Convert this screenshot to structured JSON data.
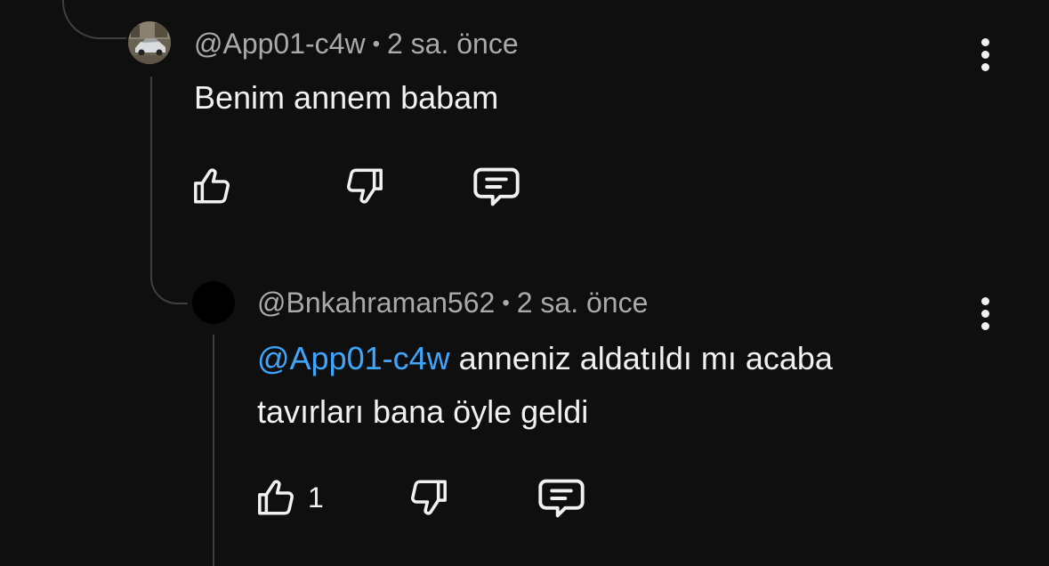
{
  "comments": [
    {
      "handle": "@App01-c4w",
      "separator": "•",
      "time": "2 sa. önce",
      "text": "Benim annem babam",
      "avatar_icon": "car-photo-avatar",
      "like_count": "",
      "icons": {
        "like": "thumbs-up-icon",
        "dislike": "thumbs-down-icon",
        "reply": "comment-icon",
        "menu": "more-vert-icon"
      }
    },
    {
      "handle": "@Bnkahraman562",
      "separator": "•",
      "time": "2 sa. önce",
      "mention": "@App01-c4w",
      "text_line1": " anneniz aldatıldı mı acaba",
      "text_line2": "tavırları bana öyle geldi",
      "avatar_icon": "black-circle-avatar",
      "like_count": "1",
      "icons": {
        "like": "thumbs-up-icon",
        "dislike": "thumbs-down-icon",
        "reply": "comment-icon",
        "menu": "more-vert-icon"
      }
    }
  ],
  "colors": {
    "background": "#0f0f0f",
    "text": "#f1f1f1",
    "meta": "#aaaaaa",
    "mention": "#3ea6ff",
    "thread_line": "#3f3f3f"
  }
}
